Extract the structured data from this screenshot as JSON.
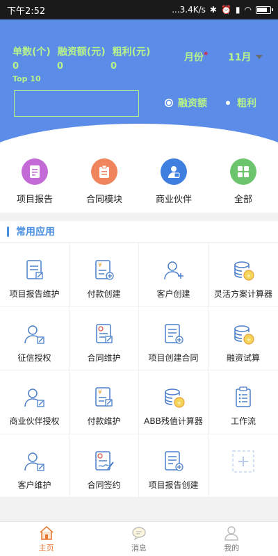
{
  "status": {
    "time": "下午2:52",
    "network": "...3.4K/s",
    "icons": [
      "bluetooth-icon",
      "alarm-icon",
      "signal-icon",
      "wifi-icon",
      "battery-icon"
    ]
  },
  "hero": {
    "labels": [
      "单数(个)",
      "融资额(元)",
      "粗利(元)"
    ],
    "values": [
      "0",
      "0",
      "0"
    ],
    "top10": "Top 10",
    "month_label": "月份",
    "required_mark": "*",
    "month_value": "11月",
    "legend": [
      "融资额",
      "粗利"
    ],
    "colors": {
      "background": "#5b8de8",
      "text": "#b7f28a"
    }
  },
  "quick": [
    {
      "label": "项目报告",
      "icon": "document-icon",
      "color": "#c36ad6"
    },
    {
      "label": "合同模块",
      "icon": "clipboard-icon",
      "color": "#f0845c"
    },
    {
      "label": "商业伙伴",
      "icon": "partner-icon",
      "color": "#3f7fe0"
    },
    {
      "label": "全部",
      "icon": "grid-icon",
      "color": "#6cc56c"
    }
  ],
  "section": {
    "title": "常用应用"
  },
  "apps": [
    {
      "label": "项目报告维护",
      "icon": "report-edit-icon"
    },
    {
      "label": "付款创建",
      "icon": "payment-add-icon"
    },
    {
      "label": "客户创建",
      "icon": "customer-add-icon"
    },
    {
      "label": "灵活方案计算器",
      "icon": "coins-calculator-icon"
    },
    {
      "label": "征信授权",
      "icon": "credit-auth-icon"
    },
    {
      "label": "合同维护",
      "icon": "contract-edit-icon"
    },
    {
      "label": "项目创建合同",
      "icon": "project-contract-icon"
    },
    {
      "label": "融资试算",
      "icon": "coins-calculator-icon"
    },
    {
      "label": "商业伙伴授权",
      "icon": "partner-auth-icon"
    },
    {
      "label": "付款维护",
      "icon": "payment-edit-icon"
    },
    {
      "label": "ABB残值计算器",
      "icon": "coins-calculator-icon"
    },
    {
      "label": "工作流",
      "icon": "workflow-icon"
    },
    {
      "label": "客户维护",
      "icon": "customer-edit-icon"
    },
    {
      "label": "合同签约",
      "icon": "contract-sign-icon"
    },
    {
      "label": "项目报告创建",
      "icon": "report-add-icon"
    },
    {
      "label": "",
      "icon": "add-app-icon"
    }
  ],
  "nav": [
    {
      "label": "主页",
      "icon": "home-icon",
      "active": true
    },
    {
      "label": "消息",
      "icon": "message-icon",
      "active": false
    },
    {
      "label": "我的",
      "icon": "profile-icon",
      "active": false
    }
  ]
}
